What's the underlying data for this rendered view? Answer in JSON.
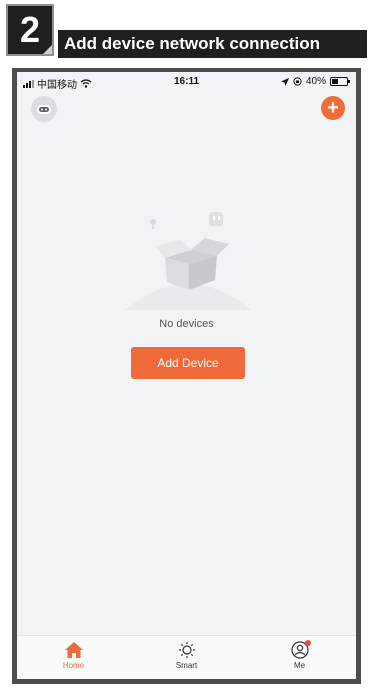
{
  "header": {
    "step_number": "2",
    "title": "Add device network connection"
  },
  "status_bar": {
    "carrier": "中国移动",
    "time": "16:11",
    "battery_percent": "40%",
    "battery_level": 0.4
  },
  "home": {
    "empty_text": "No devices",
    "add_device_label": "Add Device"
  },
  "tabs": [
    {
      "label": "Home",
      "icon": "home-icon",
      "active": true
    },
    {
      "label": "Smart",
      "icon": "sun-icon",
      "active": false
    },
    {
      "label": "Me",
      "icon": "user-icon",
      "active": false
    }
  ],
  "colors": {
    "accent": "#ef6a3b",
    "header_bg": "#1f1f1f",
    "screen_bg": "#f2f3f7"
  }
}
